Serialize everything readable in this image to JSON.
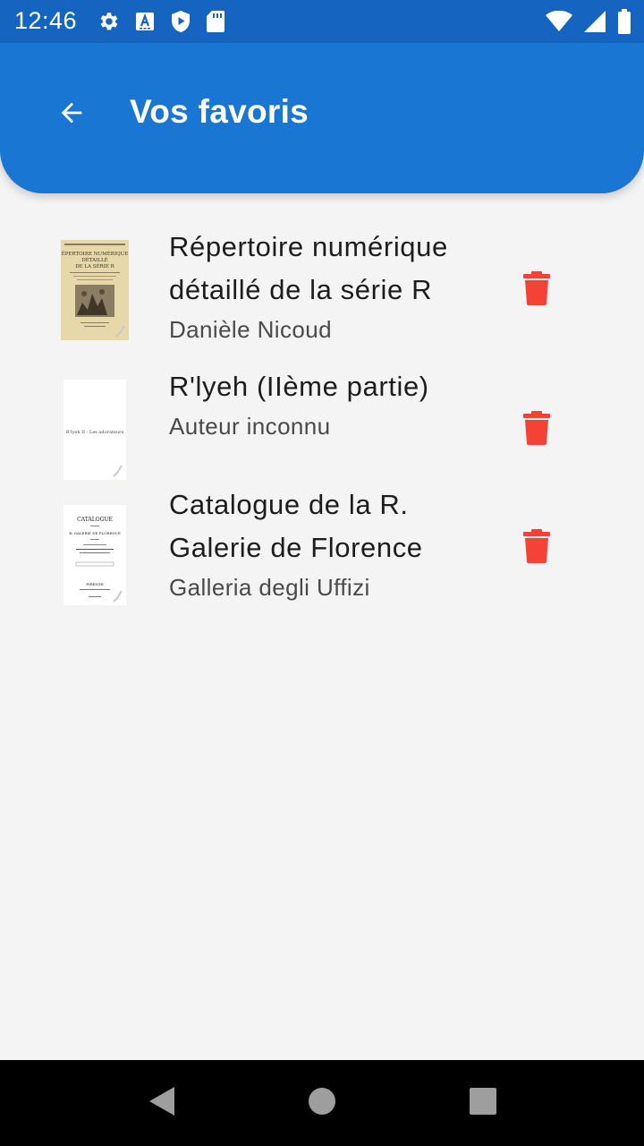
{
  "status_bar": {
    "time": "12:46",
    "left_icons": [
      "settings-icon",
      "a-keyboard-icon",
      "play-protect-icon",
      "sd-card-icon"
    ],
    "right_icons": [
      "wifi-icon",
      "signal-icon",
      "battery-icon"
    ]
  },
  "app_bar": {
    "title": "Vos favoris",
    "back_icon": "arrow-back-icon"
  },
  "favorites": [
    {
      "title_line1": "Répertoire numérique",
      "title_line2": "détaillé de la série R",
      "author": "Danièle Nicoud",
      "thumb_text": [
        "ÉPERTOIRE NUMÉRIQUE",
        "DÉTAILLÉ",
        "DE LA SÉRIE R"
      ]
    },
    {
      "title_line1": "R'lyeh (IIème partie)",
      "author": "Auteur inconnu",
      "thumb_text": [
        "R'lyeh II - Les adorateurs"
      ]
    },
    {
      "title_line1": "Catalogue de la R.",
      "title_line2": "Galerie de Florence",
      "author": "Galleria degli Uffizi",
      "thumb_text": [
        "CATALOGUE",
        "R. GALERIE DE FLORENCE",
        "FIRENZE"
      ]
    }
  ],
  "colors": {
    "status_bar": "#1565c0",
    "app_bar": "#1976d2",
    "delete": "#f44336",
    "background": "#f4f4f4"
  },
  "nav_bar": {
    "buttons": [
      "back-triangle-icon",
      "home-circle-icon",
      "recents-square-icon"
    ]
  }
}
